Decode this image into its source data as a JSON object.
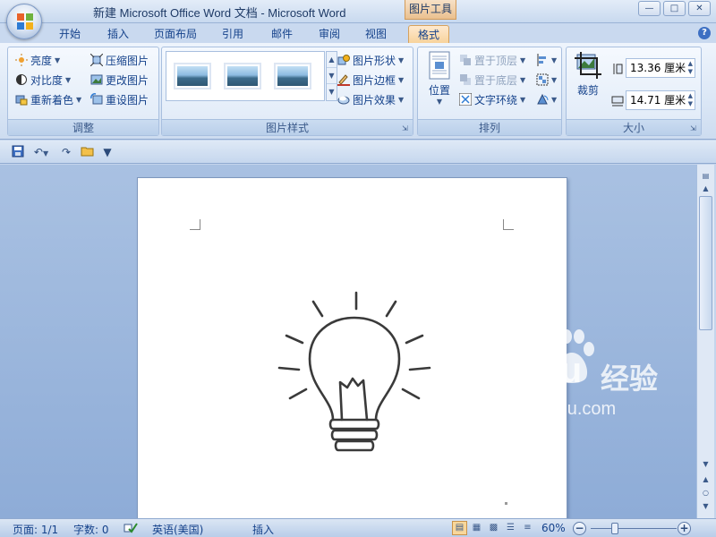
{
  "window": {
    "title": "新建 Microsoft Office Word 文档 - Microsoft Word",
    "context_tab_group": "图片工具",
    "controls": [
      "minimize",
      "maximize",
      "close"
    ]
  },
  "tabs": [
    {
      "label": "开始",
      "active": false
    },
    {
      "label": "插入",
      "active": false
    },
    {
      "label": "页面布局",
      "active": false
    },
    {
      "label": "引用",
      "active": false
    },
    {
      "label": "邮件",
      "active": false
    },
    {
      "label": "审阅",
      "active": false
    },
    {
      "label": "视图",
      "active": false
    },
    {
      "label": "格式",
      "active": true
    }
  ],
  "ribbon": {
    "adjust": {
      "label": "调整",
      "brightness": "亮度",
      "contrast": "对比度",
      "recolor": "重新着色",
      "compress": "压缩图片",
      "change": "更改图片",
      "reset": "重设图片"
    },
    "styles": {
      "label": "图片样式",
      "shape": "图片形状",
      "border": "图片边框",
      "effects": "图片效果",
      "gallery_count": 3
    },
    "arrange": {
      "label": "排列",
      "position": "位置",
      "bring_front": "置于顶层",
      "send_back": "置于底层",
      "text_wrap": "文字环绕"
    },
    "size": {
      "label": "大小",
      "crop": "裁剪",
      "height": "13.36 厘米",
      "width": "14.71 厘米"
    }
  },
  "quick_access": [
    "save-icon",
    "undo-icon",
    "redo-icon",
    "open-icon",
    "customize-icon"
  ],
  "watermark": {
    "brand": "Bai  du",
    "brand_cn": "经验",
    "url": "jingyan.baidu.com"
  },
  "status": {
    "page": "页面: 1/1",
    "words": "字数: 0",
    "language": "英语(美国)",
    "mode": "插入",
    "zoom": "60%",
    "zoom_value": 60
  },
  "colors": {
    "accent": "#15428b",
    "active_tab": "#f7d39c",
    "ribbon_bg": "#dbe7f6"
  }
}
